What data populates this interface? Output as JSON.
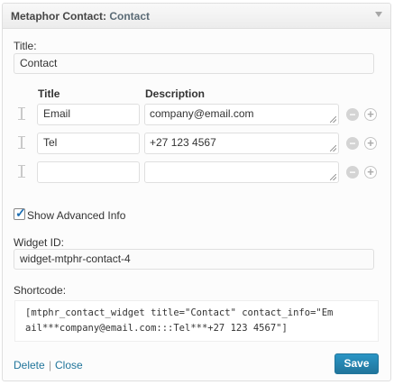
{
  "widget": {
    "header_title": "Metaphor Contact:",
    "header_subtitle": "Contact",
    "title_label": "Title:",
    "title_value": "Contact",
    "columns": {
      "title": "Title",
      "description": "Description"
    },
    "rows": [
      {
        "title": "Email",
        "description": "company@email.com"
      },
      {
        "title": "Tel",
        "description": "+27 123 4567"
      },
      {
        "title": "",
        "description": ""
      }
    ],
    "show_advanced_label": "Show Advanced Info",
    "show_advanced_checked": true,
    "widget_id_label": "Widget ID:",
    "widget_id_value": "widget-mtphr-contact-4",
    "shortcode_label": "Shortcode:",
    "shortcode_line1": "[mtphr_contact_widget title=\"Contact\" contact_info=\"Em",
    "shortcode_line2": "ail***company@email.com:::Tel***+27 123 4567\"]",
    "delete_label": "Delete",
    "separator": "|",
    "close_label": "Close",
    "save_label": "Save"
  },
  "icons": {
    "row_handle": "drag-handle-icon",
    "remove": "minus-circle-icon",
    "add": "plus-circle-icon",
    "toggle": "triangle-down-icon",
    "resize": "resize-grip-icon"
  },
  "colors": {
    "accent": "#21759b",
    "header_text": "#464646",
    "border": "#dfdfdf"
  }
}
